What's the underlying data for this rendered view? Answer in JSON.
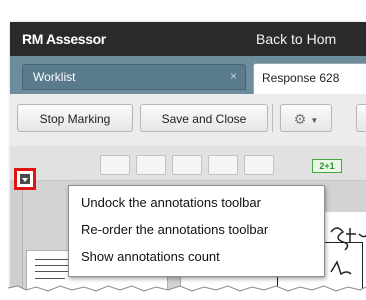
{
  "header": {
    "brand": "RM Assessor",
    "back_link": "Back to Hom"
  },
  "tabs": [
    {
      "label": "Worklist",
      "close": "×"
    },
    {
      "label": "Response 628"
    }
  ],
  "toolbar": {
    "stop_marking": "Stop Marking",
    "save_and_close": "Save and Close",
    "gear": "⚙",
    "caret": "▼"
  },
  "annotations_row": {
    "badge": "2+1"
  },
  "annotations_menu": {
    "items": [
      "Undock the annotations toolbar",
      "Re-order the annotations toolbar",
      "Show annotations count"
    ]
  },
  "icons": {
    "dropdown": "annotations-menu-icon",
    "gear": "gear-icon"
  },
  "colors": {
    "highlight": "#e11313",
    "header_bg": "#2a2a2a",
    "tab_strip": "#6d8d9d",
    "badge_green": "#43a543"
  }
}
